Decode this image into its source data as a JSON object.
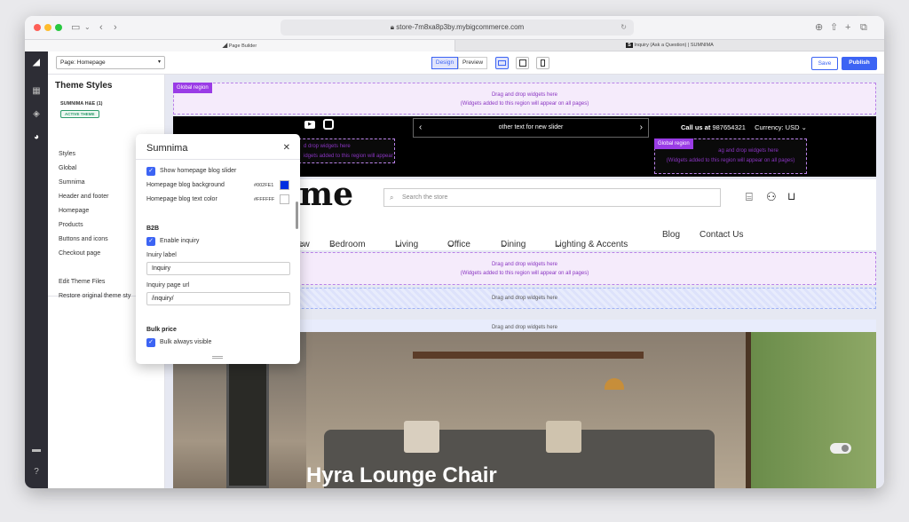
{
  "browser": {
    "url": "store-7m8xa8p3by.mybigcommerce.com",
    "tabs": [
      {
        "label": "Page Builder"
      },
      {
        "label": "Inquiry (Ask a Question) | SUMNIMA"
      }
    ]
  },
  "topbar": {
    "page_select": "Page: Homepage",
    "design_label": "Design",
    "preview_label": "Preview",
    "save_label": "Save",
    "publish_label": "Publish"
  },
  "sidebar": {
    "title": "Theme Styles",
    "theme_name": "SUMNIMA H&E (1)",
    "active_badge": "ACTIVE THEME",
    "items": [
      "Styles",
      "Global",
      "Sumnima",
      "Header and footer",
      "Homepage",
      "Products",
      "Buttons and icons",
      "Checkout page"
    ],
    "edit_files": "Edit Theme Files",
    "restore": "Restore original theme sty"
  },
  "panel": {
    "title": "Sumnima",
    "show_blog_slider": "Show homepage blog slider",
    "blog_bg_label": "Homepage blog background",
    "blog_bg_value": "#002FE1",
    "blog_text_label": "Homepage blog text color",
    "blog_text_value": "#FFFFFF",
    "b2b_heading": "B2B",
    "enable_inquiry": "Enable inquiry",
    "inquiry_label_caption": "Inuiry label",
    "inquiry_label_value": "Inquiry",
    "inquiry_url_caption": "Inquiry page url",
    "inquiry_url_value": "/inquiry/",
    "bulk_heading": "Bulk price",
    "bulk_visible": "Bulk always visible"
  },
  "canvas": {
    "global_region": "Global region",
    "drag_text": "Drag and drop widgets here",
    "global_note": "(Widgets added to this region will appear on all pages)",
    "drag_partial": "ag and drop widgets here",
    "drag_partial_left": "d drop widgets here",
    "note_partial_left": "idgets added to this region will appear on all pages)",
    "slider_text": "other text for new slider",
    "call_label": "Call us at",
    "phone": "987654321",
    "currency": "Currency: USD",
    "logo_partial": "me",
    "search_placeholder": "Search the store",
    "nav": [
      "ew",
      "Bedroom",
      "Living",
      "Office",
      "Dining",
      "Lighting & Accents",
      "Blog",
      "Contact Us"
    ],
    "hero_title": "Hyra Lounge Chair"
  },
  "colors": {
    "accent": "#3c64f4",
    "global": "#9a3ce6",
    "blog_bg": "#002FE1"
  }
}
